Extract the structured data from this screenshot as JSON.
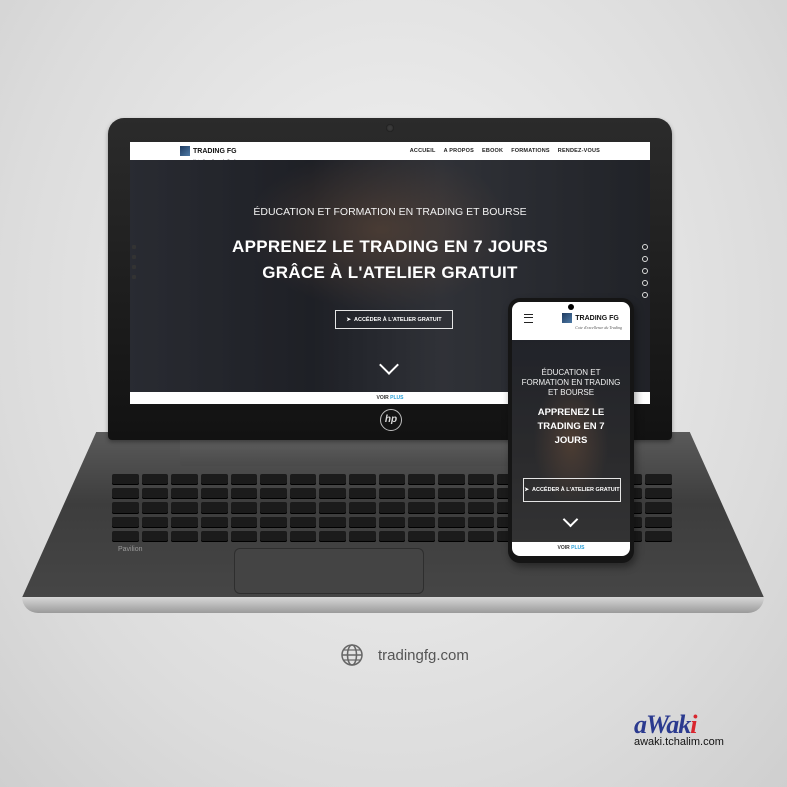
{
  "site": {
    "brand": "TRADING FG",
    "tagline": "Cote d'excellence du Trading",
    "nav": [
      "ACCUEIL",
      "A PROPOS",
      "EBOOK",
      "FORMATIONS",
      "RENDEZ-VOUS"
    ],
    "hero_subtitle": "ÉDUCATION ET FORMATION EN TRADING ET BOURSE",
    "hero_title_line1": "APPRENEZ LE TRADING EN 7 JOURS",
    "hero_title_line2": "GRÂCE À L'ATELIER GRATUIT",
    "cta": "ACCÉDER À L'ATELIER GRATUIT",
    "see_more": "VOIR",
    "see_more_accent": "PLUS"
  },
  "mobile": {
    "hero_subtitle": "ÉDUCATION ET FORMATION EN TRADING ET BOURSE",
    "hero_title": "APPRENEZ LE TRADING EN 7 JOURS",
    "cta": "ACCÉDER À L'ATELIER GRATUIT"
  },
  "device": {
    "laptop_brand": "hp",
    "laptop_model": "Pavilion"
  },
  "footer": {
    "domain": "tradingfg.com",
    "credit_logo_main": "aWak",
    "credit_logo_accent": "i",
    "credit_url": "awaki.tchalim.com"
  },
  "colors": {
    "accent": "#2aa0d8",
    "credit_blue": "#2b3a8f",
    "credit_red": "#d8262e"
  },
  "icons": [
    "globe-icon",
    "menu-icon",
    "paper-plane-icon",
    "chevron-down-icon"
  ]
}
